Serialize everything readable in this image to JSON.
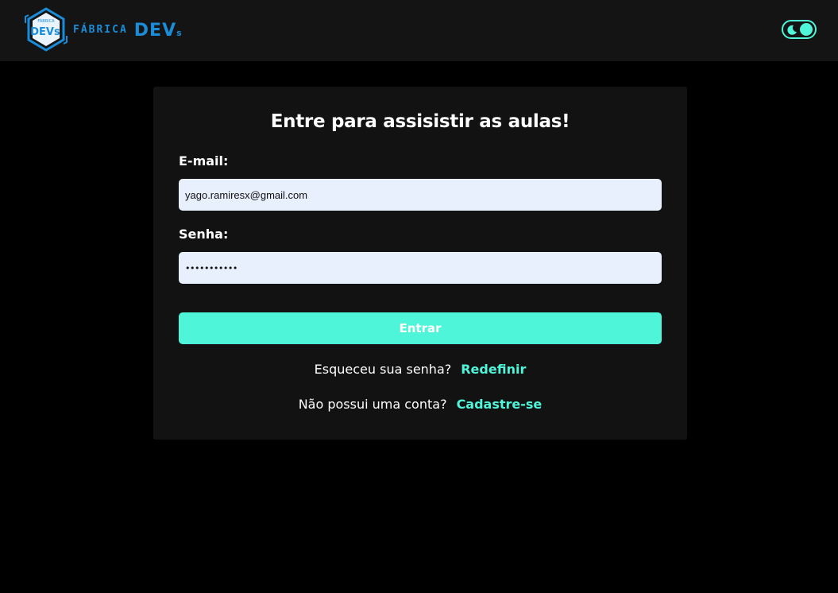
{
  "header": {
    "logo_badge_top_text": "FÁBRICA",
    "logo_badge_text": "DEVs",
    "logo_fabrica": "FÁBRICA",
    "logo_devs": "DEV",
    "logo_devs_s": "s",
    "theme_toggle_icon": "moon-icon"
  },
  "login": {
    "title": "Entre para assisistir as aulas!",
    "email_label": "E-mail:",
    "email_value": "yago.ramiresx@gmail.com",
    "password_label": "Senha:",
    "password_value": "ramires1234",
    "submit_label": "Entrar",
    "forgot_prompt": "Esqueceu sua senha?",
    "forgot_link": "Redefinir",
    "signup_prompt": "Não possui uma conta?",
    "signup_link": "Cadastre-se"
  },
  "colors": {
    "accent": "#4ff5d8",
    "brand_blue": "#1a8cd8",
    "page_bg": "#000000",
    "card_bg": "#121212",
    "topbar_bg": "#141414",
    "input_bg": "#e8f0fe"
  }
}
